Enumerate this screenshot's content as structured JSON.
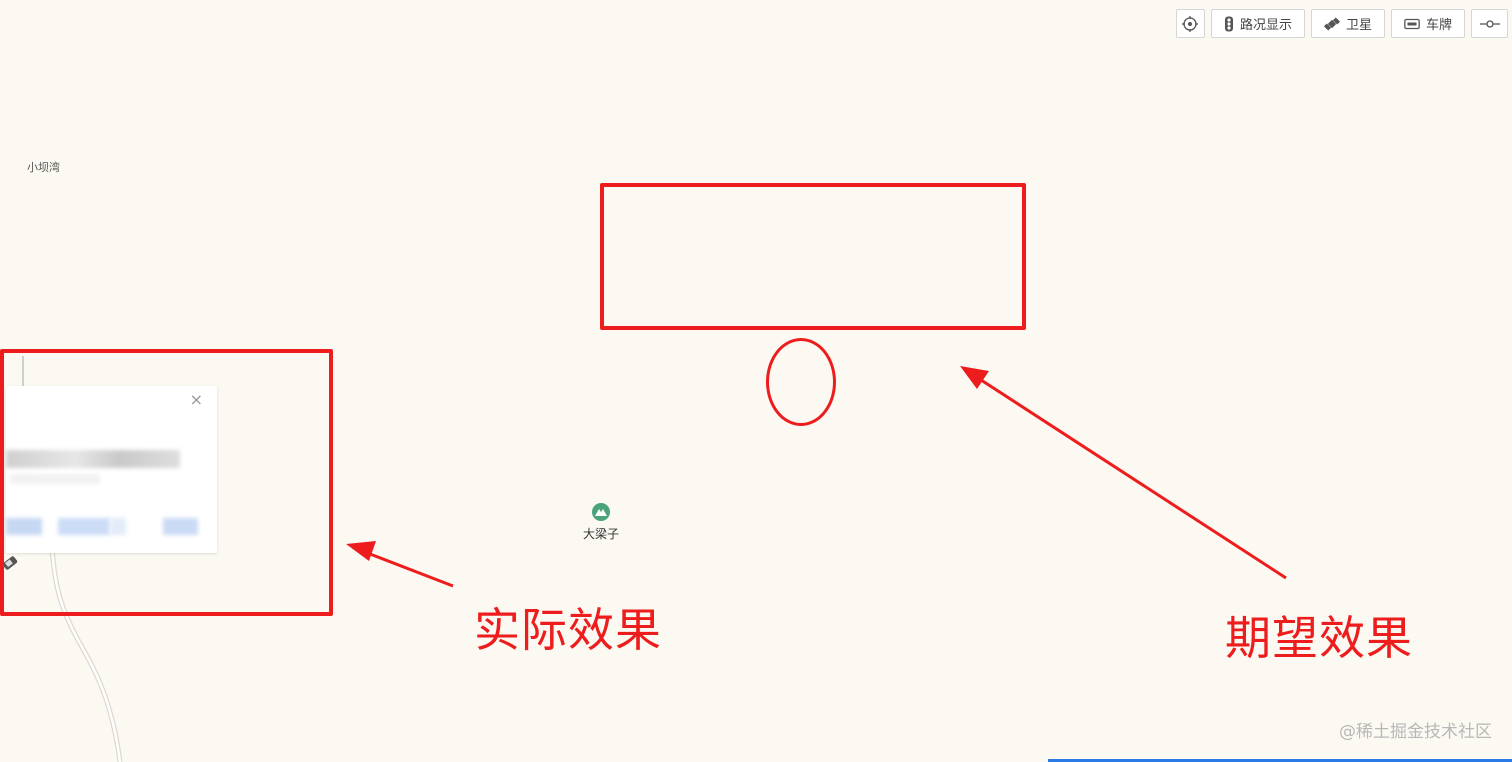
{
  "map": {
    "labels": {
      "xiaobawan": "小坝湾"
    },
    "poi": {
      "label": "大梁子",
      "icon": "mountain-icon",
      "color": "#4aa37a"
    }
  },
  "toolbar": {
    "locate_icon": "crosshair-icon",
    "traffic": {
      "label": "路况显示",
      "icon": "traffic-light-icon"
    },
    "satellite": {
      "label": "卫星",
      "icon": "satellite-icon"
    },
    "plate": {
      "label": "车牌",
      "icon": "license-plate-icon"
    },
    "extra_icon": "ruler-icon"
  },
  "info_window": {
    "close_label": "×"
  },
  "annotations": {
    "actual_label": "实际效果",
    "expected_label": "期望效果",
    "color": "#ee1d1d"
  },
  "watermark": "@稀土掘金技术社区"
}
